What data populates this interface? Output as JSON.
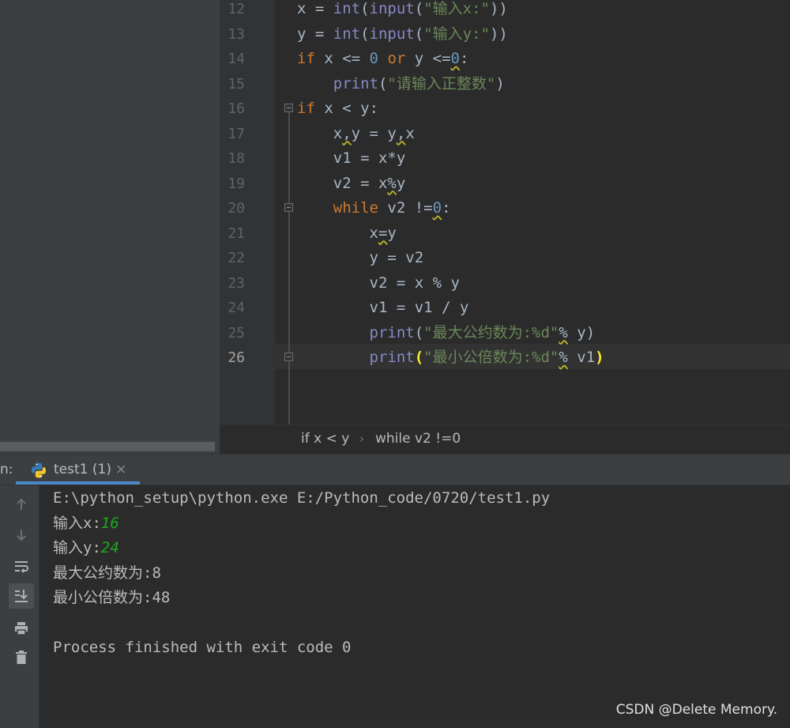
{
  "editor": {
    "line_numbers": [
      "12",
      "13",
      "14",
      "15",
      "16",
      "17",
      "18",
      "19",
      "20",
      "21",
      "22",
      "23",
      "24",
      "25",
      "26"
    ],
    "lines": [
      [
        {
          "t": "x = "
        },
        {
          "t": "int",
          "c": "bi"
        },
        {
          "t": "("
        },
        {
          "t": "input",
          "c": "bi"
        },
        {
          "t": "("
        },
        {
          "t": "\"输入x:\"",
          "c": "str"
        },
        {
          "t": "))"
        }
      ],
      [
        {
          "t": "y = "
        },
        {
          "t": "int",
          "c": "bi"
        },
        {
          "t": "("
        },
        {
          "t": "input",
          "c": "bi"
        },
        {
          "t": "("
        },
        {
          "t": "\"输入y:\"",
          "c": "str"
        },
        {
          "t": "))"
        }
      ],
      [
        {
          "t": "if",
          "c": "kw"
        },
        {
          "t": " x <= "
        },
        {
          "t": "0",
          "c": "num"
        },
        {
          "t": " "
        },
        {
          "t": "or",
          "c": "kw"
        },
        {
          "t": " y <="
        },
        {
          "t": "0",
          "c": "num squig"
        },
        {
          "t": ":"
        }
      ],
      [
        {
          "t": "    "
        },
        {
          "t": "print",
          "c": "bi"
        },
        {
          "t": "("
        },
        {
          "t": "\"请输入正整数\"",
          "c": "str"
        },
        {
          "t": ")"
        }
      ],
      [
        {
          "t": "if",
          "c": "kw"
        },
        {
          "t": " x < y:"
        }
      ],
      [
        {
          "t": "    x"
        },
        {
          "t": ",",
          "c": "squig"
        },
        {
          "t": "y = y"
        },
        {
          "t": ",",
          "c": "squig"
        },
        {
          "t": "x"
        }
      ],
      [
        {
          "t": "    v1 = x*y"
        }
      ],
      [
        {
          "t": "    v2 = x"
        },
        {
          "t": "%",
          "c": "squig"
        },
        {
          "t": "y"
        }
      ],
      [
        {
          "t": "    "
        },
        {
          "t": "while",
          "c": "kw"
        },
        {
          "t": " v2 !="
        },
        {
          "t": "0",
          "c": "num squig"
        },
        {
          "t": ":"
        }
      ],
      [
        {
          "t": "        x"
        },
        {
          "t": "=",
          "c": "squig"
        },
        {
          "t": "y"
        }
      ],
      [
        {
          "t": "        y = v2"
        }
      ],
      [
        {
          "t": "        v2 = x % y"
        }
      ],
      [
        {
          "t": "        v1 = v1 / y"
        }
      ],
      [
        {
          "t": "        "
        },
        {
          "t": "print",
          "c": "bi"
        },
        {
          "t": "("
        },
        {
          "t": "\"最大公约数为:%d\"",
          "c": "str"
        },
        {
          "t": "%",
          "c": "squig"
        },
        {
          "t": " y)"
        }
      ],
      [
        {
          "t": "        "
        },
        {
          "t": "print",
          "c": "bi"
        },
        {
          "t": "(",
          "c": "brace"
        },
        {
          "t": "\"最小公倍数为:%d\"",
          "c": "str"
        },
        {
          "t": "%",
          "c": "squig"
        },
        {
          "t": " v1"
        },
        {
          "t": ")",
          "c": "brace"
        }
      ]
    ],
    "current_line_index": 14
  },
  "breadcrumb": {
    "items": [
      "if x < y",
      "while v2 !=0"
    ],
    "separator": "›"
  },
  "run_panel": {
    "label": "n:",
    "tab_label": "test1 (1)",
    "tab_close": "×",
    "console": {
      "command": "E:\\python_setup\\python.exe E:/Python_code/0720/test1.py",
      "prompt_x": "输入x:",
      "input_x": "16",
      "prompt_y": "输入y:",
      "input_y": "24",
      "gcd_line": "最大公约数为:8",
      "lcm_line": "最小公倍数为:48",
      "exit_line": "Process finished with exit code 0"
    }
  },
  "watermark": "CSDN @Delete Memory.",
  "icons": {
    "toolbar": [
      "arrow-up-icon",
      "arrow-down-icon",
      "soft-wrap-icon",
      "scroll-to-end-icon",
      "print-icon",
      "trash-icon"
    ]
  },
  "colors": {
    "keyword": "#cc7832",
    "builtin": "#8888c6",
    "string": "#6a8759",
    "number": "#6897bb",
    "console_input": "#1ea81e",
    "tab_accent": "#4a88c7"
  }
}
